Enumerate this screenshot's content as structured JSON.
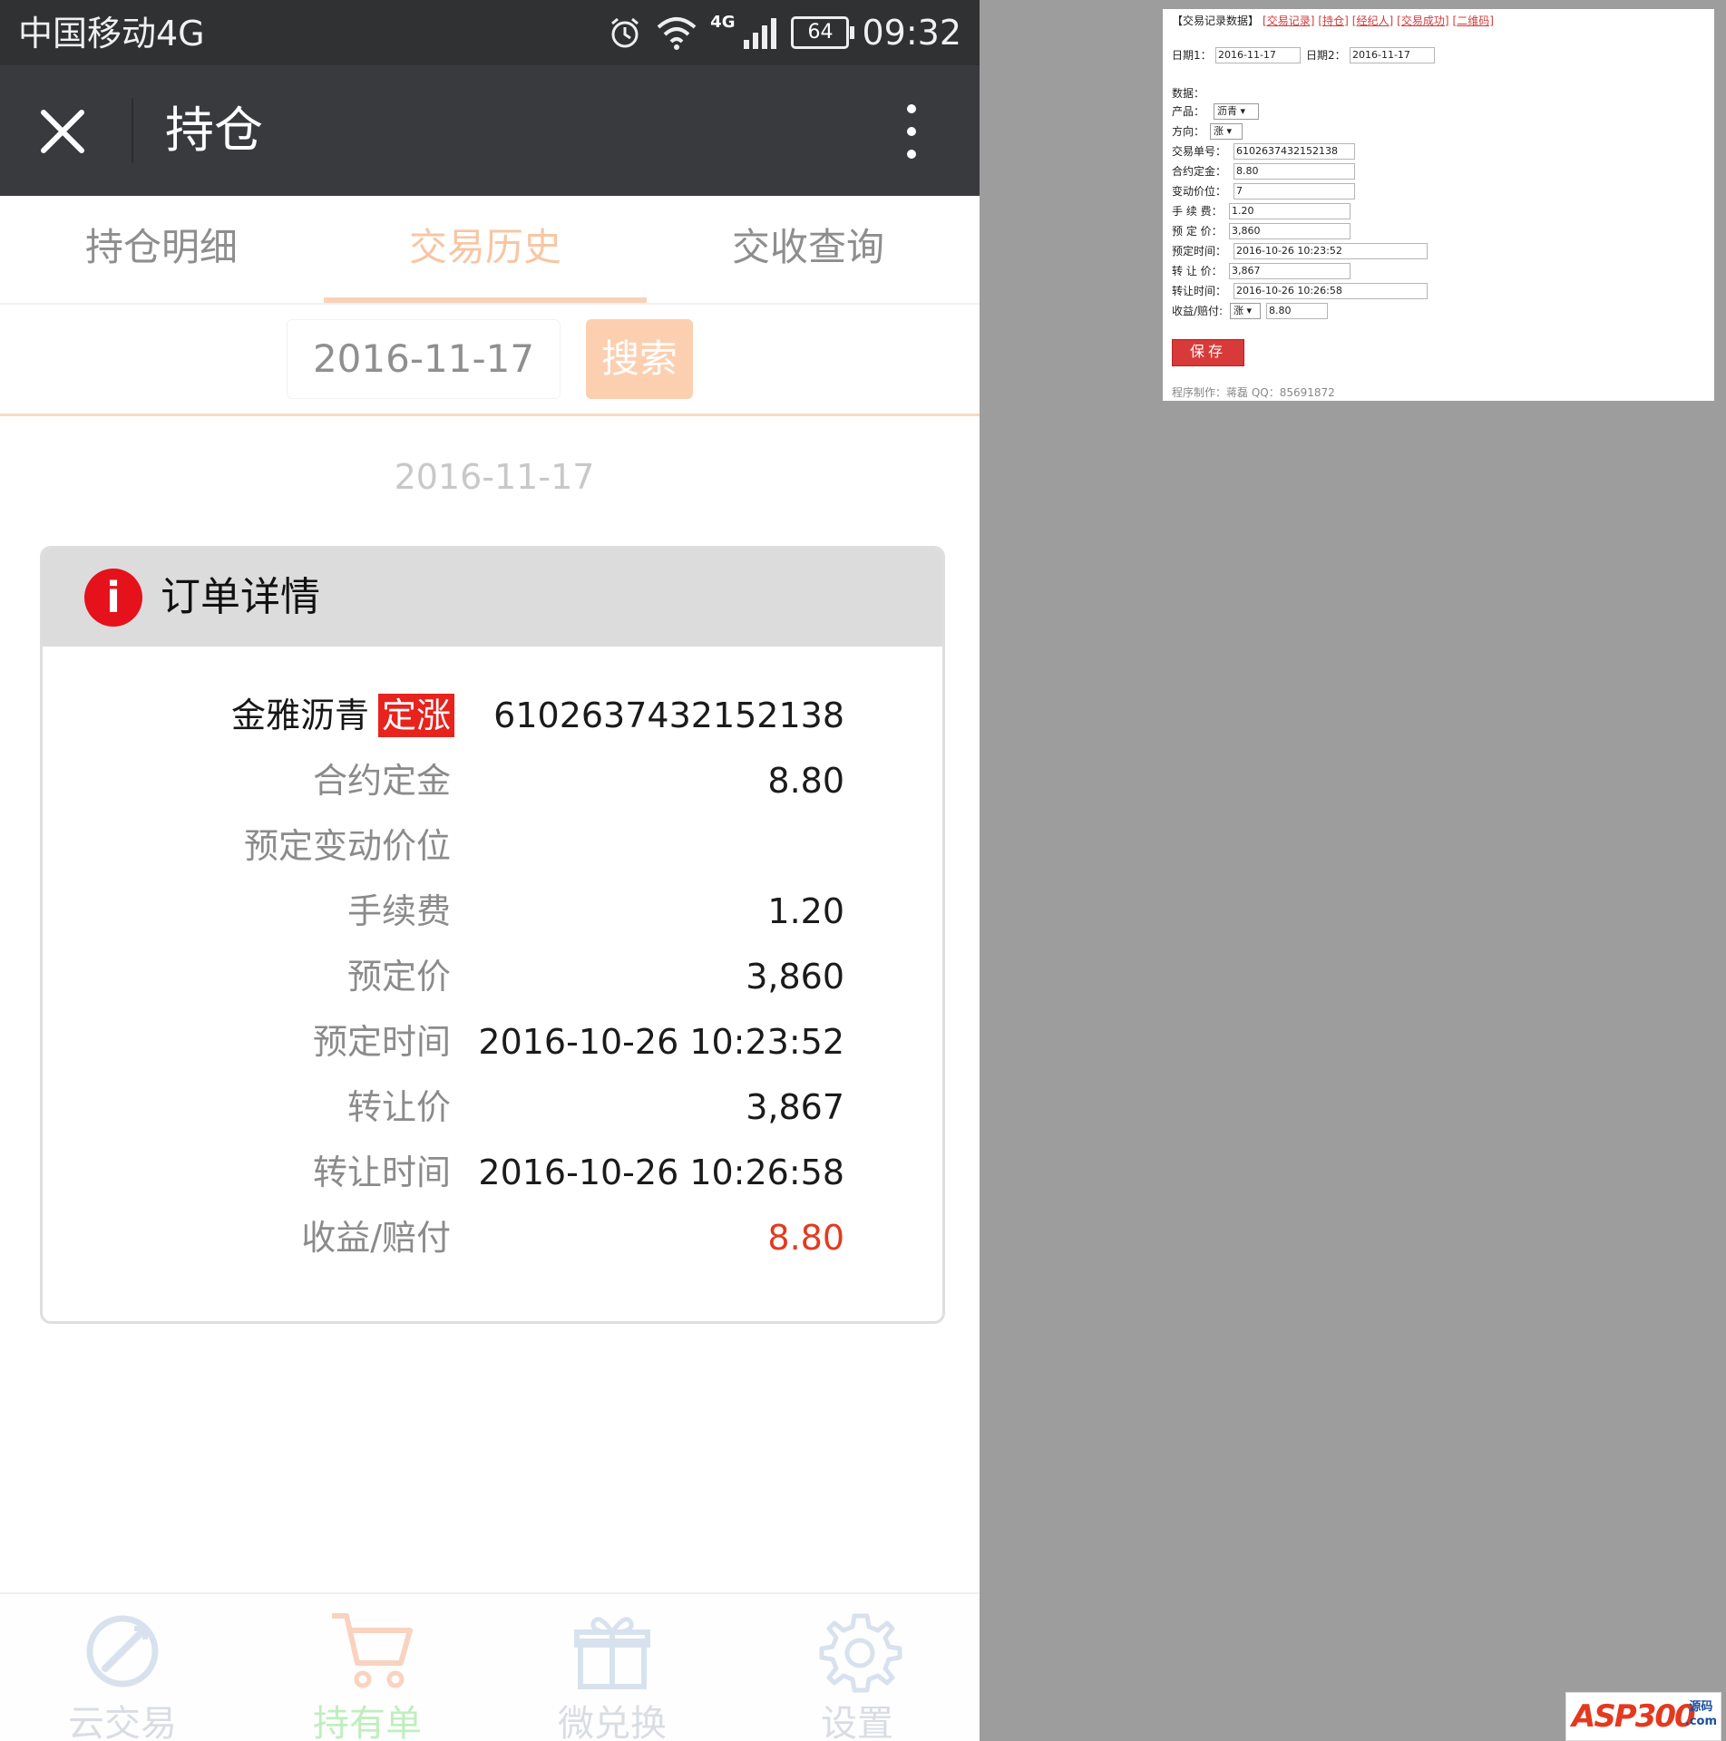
{
  "status_bar": {
    "carrier": "中国移动4G",
    "network": "4G",
    "battery": "64",
    "time": "09:32"
  },
  "title_bar": {
    "title": "持仓"
  },
  "tabs": [
    {
      "label": "持仓明细"
    },
    {
      "label": "交易历史"
    },
    {
      "label": "交收查询"
    }
  ],
  "search": {
    "date_value": "2016-11-17",
    "button_label": "搜索"
  },
  "history_date": "2016-11-17",
  "order_card": {
    "title": "订单详情",
    "product": "金雅沥青",
    "badge": "定涨",
    "order_no": "6102637432152138",
    "rows": [
      {
        "label": "合约定金",
        "value": "8.80"
      },
      {
        "label": "预定变动价位",
        "value": ""
      },
      {
        "label": "手续费",
        "value": "1.20"
      },
      {
        "label": "预定价",
        "value": "3,860"
      },
      {
        "label": "预定时间",
        "value": "2016-10-26 10:23:52"
      },
      {
        "label": "转让价",
        "value": "3,867"
      },
      {
        "label": "转让时间",
        "value": "2016-10-26 10:26:58"
      },
      {
        "label": "收益/赔付",
        "value": "8.80"
      }
    ],
    "profit_color": "#e33a1f"
  },
  "bottom_nav": [
    {
      "label": "云交易",
      "icon": "cloud-trade-icon"
    },
    {
      "label": "持有单",
      "icon": "cart-icon"
    },
    {
      "label": "微兑换",
      "icon": "gift-icon"
    },
    {
      "label": "设置",
      "icon": "gear-icon"
    }
  ],
  "colors": {
    "accent": "#f8d2b8",
    "title_bar": "#393a3d",
    "active_nav": "#bfeebe",
    "danger": "#e5111b"
  },
  "admin_panel": {
    "header_title": "【交易记录数据】",
    "header_links": [
      "[交易记录]",
      "[持仓]",
      "[经纪人]",
      "[交易成功]",
      "[二维码]"
    ],
    "date1_label": "日期1：",
    "date1_value": "2016-11-17",
    "date2_label": "日期2：",
    "date2_value": "2016-11-17",
    "data_label": "数据：",
    "product_label": "产品：",
    "product_value": "沥青",
    "direction_label": "方向：",
    "direction_value": "涨",
    "fields": [
      {
        "label": "交易单号：",
        "value": "6102637432152138"
      },
      {
        "label": "合约定金：",
        "value": "8.80"
      },
      {
        "label": "变动价位：",
        "value": "7"
      },
      {
        "label": "手 续 费：",
        "value": "1.20"
      },
      {
        "label": "预 定 价：",
        "value": "3,860"
      },
      {
        "label": "预定时间：",
        "value": "2016-10-26 10:23:52"
      },
      {
        "label": "转 让 价：",
        "value": "3,867"
      },
      {
        "label": "转让时间：",
        "value": "2016-10-26 10:26:58"
      }
    ],
    "profit_label": "收益/赔付:",
    "profit_direction": "涨",
    "profit_value": "8.80",
    "save_label": "保存",
    "credit": "程序制作：蒋磊 QQ：85691872"
  },
  "watermark": {
    "text": "ASP300",
    "sub_top": "源码",
    "sub_bottom": ".com"
  }
}
